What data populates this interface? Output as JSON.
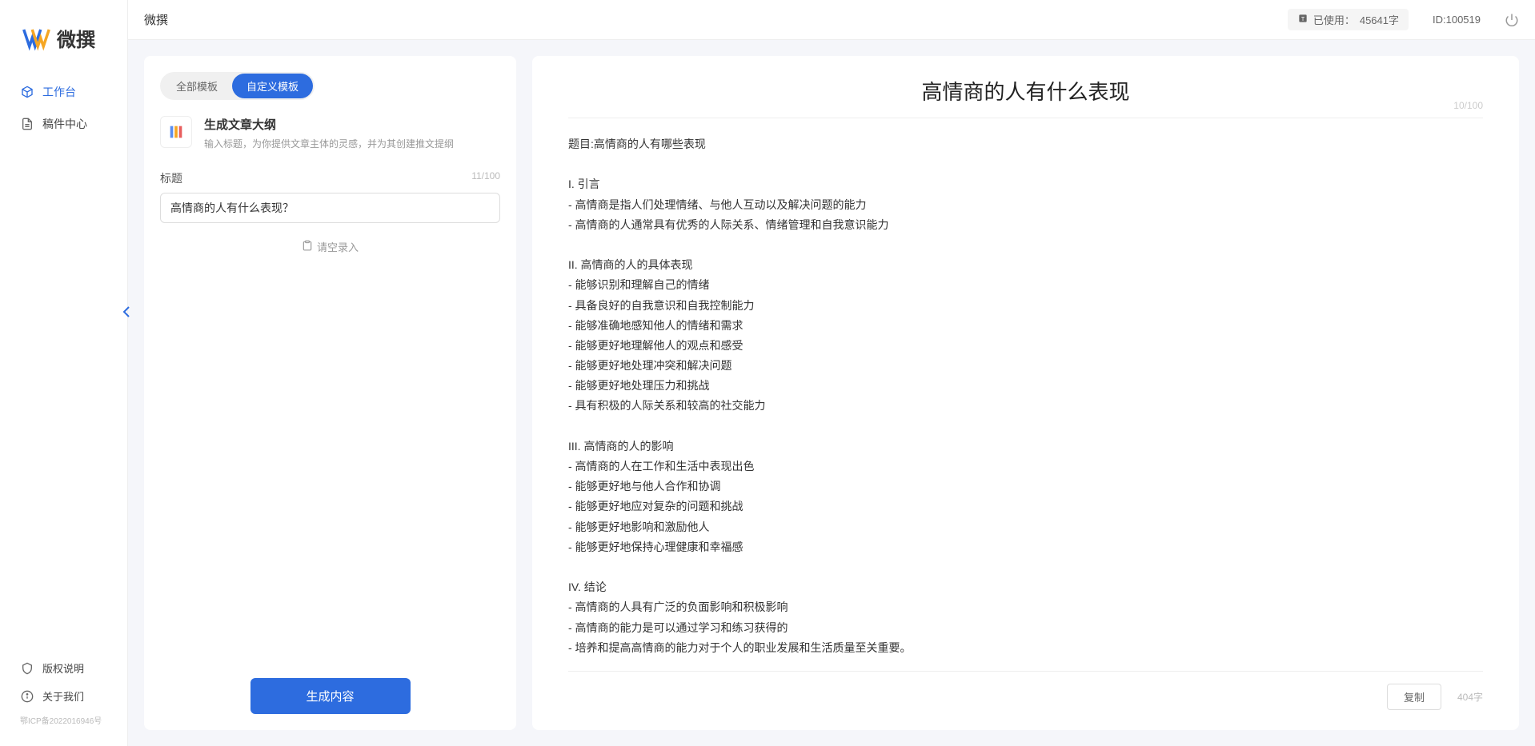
{
  "app": {
    "logo_text": "微撰"
  },
  "sidebar": {
    "nav": [
      {
        "label": "工作台",
        "active": true
      },
      {
        "label": "稿件中心",
        "active": false
      }
    ],
    "bottom": [
      {
        "label": "版权说明"
      },
      {
        "label": "关于我们"
      }
    ],
    "icp": "鄂ICP备2022016946号"
  },
  "header": {
    "title": "微撰",
    "usage_prefix": "已使用：",
    "usage_value": "45641字",
    "id_label": "ID:100519"
  },
  "left": {
    "tabs": [
      {
        "label": "全部模板",
        "active": false
      },
      {
        "label": "自定义模板",
        "active": true
      }
    ],
    "template": {
      "title": "生成文章大纲",
      "desc": "输入标题，为你提供文章主体的灵感，并为其创建推文提纲"
    },
    "field": {
      "label": "标题",
      "count": "11/100",
      "value": "高情商的人有什么表现？"
    },
    "record": "请空录入",
    "generate": "生成内容"
  },
  "right": {
    "title": "高情商的人有什么表现",
    "title_count": "10/100",
    "body": "题目:高情商的人有哪些表现\n\nI. 引言\n- 高情商是指人们处理情绪、与他人互动以及解决问题的能力\n- 高情商的人通常具有优秀的人际关系、情绪管理和自我意识能力\n\nII. 高情商的人的具体表现\n- 能够识别和理解自己的情绪\n- 具备良好的自我意识和自我控制能力\n- 能够准确地感知他人的情绪和需求\n- 能够更好地理解他人的观点和感受\n- 能够更好地处理冲突和解决问题\n- 能够更好地处理压力和挑战\n- 具有积极的人际关系和较高的社交能力\n\nIII. 高情商的人的影响\n- 高情商的人在工作和生活中表现出色\n- 能够更好地与他人合作和协调\n- 能够更好地应对复杂的问题和挑战\n- 能够更好地影响和激励他人\n- 能够更好地保持心理健康和幸福感\n\nIV. 结论\n- 高情商的人具有广泛的负面影响和积极影响\n- 高情商的能力是可以通过学习和练习获得的\n- 培养和提高高情商的能力对于个人的职业发展和生活质量至关重要。",
    "copy": "复制",
    "word_count": "404字"
  }
}
